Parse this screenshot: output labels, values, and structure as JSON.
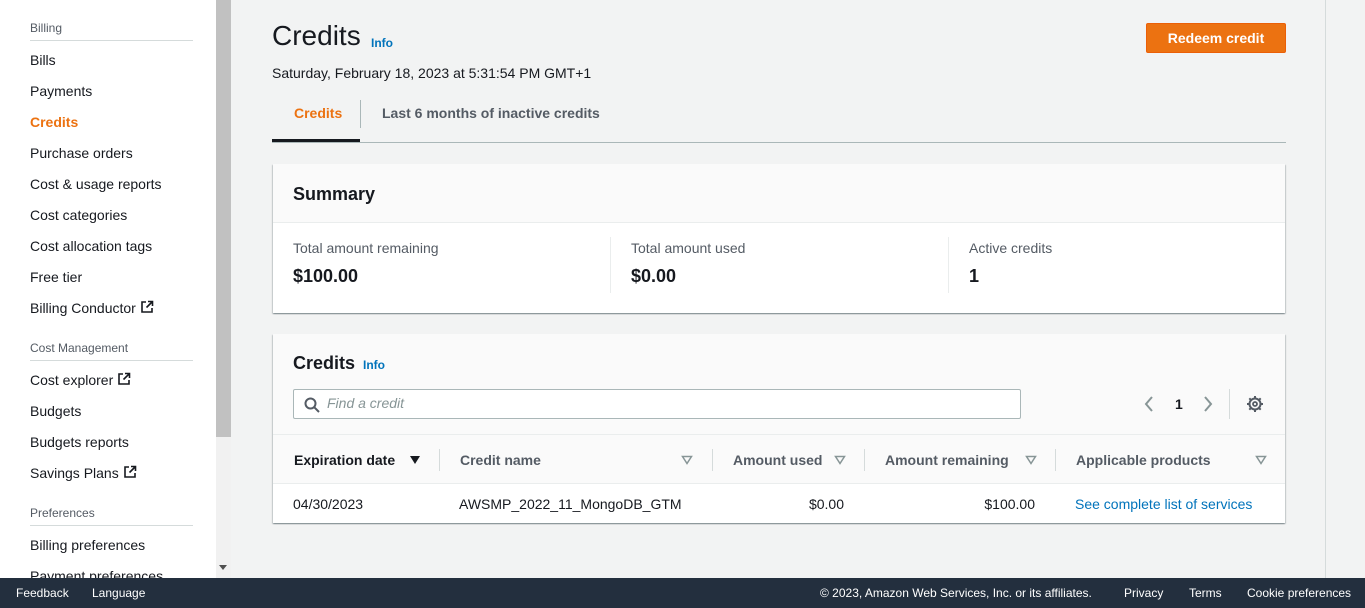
{
  "sidebar": {
    "section_billing": "Billing",
    "billing_items": [
      {
        "label": "Bills"
      },
      {
        "label": "Payments"
      },
      {
        "label": "Credits"
      },
      {
        "label": "Purchase orders"
      },
      {
        "label": "Cost & usage reports"
      },
      {
        "label": "Cost categories"
      },
      {
        "label": "Cost allocation tags"
      },
      {
        "label": "Free tier"
      },
      {
        "label": "Billing Conductor"
      }
    ],
    "section_cost": "Cost Management",
    "cost_items": [
      {
        "label": "Cost explorer"
      },
      {
        "label": "Budgets"
      },
      {
        "label": "Budgets reports"
      },
      {
        "label": "Savings Plans"
      }
    ],
    "section_prefs": "Preferences",
    "pref_items": [
      {
        "label": "Billing preferences"
      },
      {
        "label": "Payment preferences"
      }
    ],
    "active_item": "Credits"
  },
  "header": {
    "title": "Credits",
    "info": "Info",
    "date": "Saturday, February 18, 2023 at 5:31:54 PM GMT+1",
    "redeem_label": "Redeem credit"
  },
  "tabs": [
    {
      "label": "Credits"
    },
    {
      "label": "Last 6 months of inactive credits"
    }
  ],
  "summary": {
    "title": "Summary",
    "total_remaining_label": "Total amount remaining",
    "total_remaining_value": "$100.00",
    "total_used_label": "Total amount used",
    "total_used_value": "$0.00",
    "active_label": "Active credits",
    "active_value": "1"
  },
  "credits_table": {
    "title": "Credits",
    "info": "Info",
    "search_placeholder": "Find a credit",
    "page": "1",
    "columns": [
      "Expiration date",
      "Credit name",
      "Amount used",
      "Amount remaining",
      "Applicable products"
    ],
    "rows": [
      {
        "expiration": "04/30/2023",
        "name": "AWSMP_2022_11_MongoDB_GTM",
        "used": "$0.00",
        "remaining": "$100.00",
        "products": "See complete list of services"
      }
    ]
  },
  "footer": {
    "feedback": "Feedback",
    "language": "Language",
    "copyright": "© 2023, Amazon Web Services, Inc. or its affiliates.",
    "privacy": "Privacy",
    "terms": "Terms",
    "cookies": "Cookie preferences"
  },
  "colors": {
    "accent": "#ec7211",
    "link": "#0073bb",
    "footer_bg": "#232f3e"
  }
}
